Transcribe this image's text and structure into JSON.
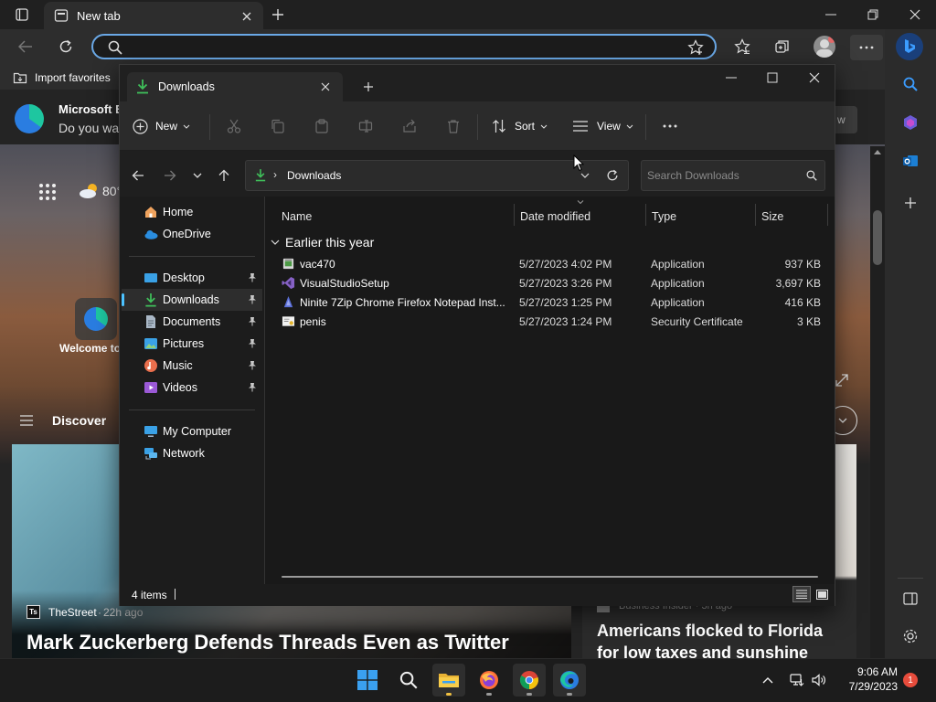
{
  "browser": {
    "tab_title": "New tab",
    "favorites_bar": {
      "import_label": "Import favorites"
    },
    "banner": {
      "title": "Microsoft E",
      "subtitle": "Do you wa",
      "button_fragment": "w"
    },
    "weather": "80°",
    "welcome_text": "Welcome to",
    "discover_label": "Discover",
    "cards": {
      "left": {
        "source": "TheStreet",
        "source_abbr": "Ts",
        "age": "22h ago",
        "headline": "Mark Zuckerberg Defends Threads Even as Twitter"
      },
      "right": {
        "source_line": "Business Insider · 3h ago",
        "headline_line1": "Americans flocked to Florida",
        "headline_line2": "for low taxes and sunshine"
      }
    },
    "notification_badge": "1"
  },
  "explorer": {
    "tab_title": "Downloads",
    "commands": {
      "new": "New",
      "sort": "Sort",
      "view": "View"
    },
    "breadcrumb": "Downloads",
    "search_placeholder": "Search Downloads",
    "nav": {
      "home": "Home",
      "onedrive": "OneDrive",
      "desktop": "Desktop",
      "downloads": "Downloads",
      "documents": "Documents",
      "pictures": "Pictures",
      "music": "Music",
      "videos": "Videos",
      "my_computer": "My Computer",
      "network": "Network"
    },
    "columns": {
      "name": "Name",
      "date": "Date modified",
      "type": "Type",
      "size": "Size"
    },
    "group_label": "Earlier this year",
    "files": [
      {
        "name": "vac470",
        "date": "5/27/2023 4:02 PM",
        "type": "Application",
        "size": "937 KB",
        "icon": "installer-icon"
      },
      {
        "name": "VisualStudioSetup",
        "date": "5/27/2023 3:26 PM",
        "type": "Application",
        "size": "3,697 KB",
        "icon": "visual-studio-icon"
      },
      {
        "name": "Ninite 7Zip Chrome Firefox Notepad Inst...",
        "date": "5/27/2023 1:25 PM",
        "type": "Application",
        "size": "416 KB",
        "icon": "ninite-icon"
      },
      {
        "name": "penis",
        "date": "5/27/2023 1:24 PM",
        "type": "Security Certificate",
        "size": "3 KB",
        "icon": "certificate-icon"
      }
    ],
    "status": "4 items"
  },
  "taskbar": {
    "clock_time": "9:06 AM",
    "clock_date": "7/29/2023"
  },
  "colors": {
    "accent": "#4cc2ff",
    "address_focus": "#6aa8e6",
    "download_green": "#3fbf5a",
    "badge_red": "#e74c3c"
  }
}
